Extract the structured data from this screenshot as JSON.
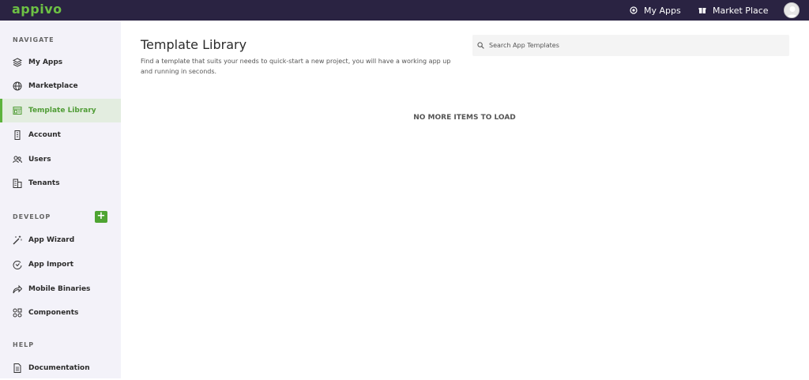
{
  "brand": {
    "logo_text": "appivo",
    "accent": "#5db33d",
    "topbar_bg": "#2a2342"
  },
  "topbar": {
    "my_apps_label": "My Apps",
    "my_apps_icon": "apps-icon",
    "market_label": "Market Place",
    "market_icon": "gift-icon"
  },
  "sidebar": {
    "navigate_label": "NAVIGATE",
    "navigate_items": [
      {
        "label": "My Apps",
        "icon": "layers-icon"
      },
      {
        "label": "Marketplace",
        "icon": "globe-icon"
      },
      {
        "label": "Template Library",
        "icon": "template-icon",
        "active": true
      },
      {
        "label": "Account",
        "icon": "building-icon"
      },
      {
        "label": "Users",
        "icon": "users-icon"
      },
      {
        "label": "Tenants",
        "icon": "buildings-icon"
      }
    ],
    "develop_label": "DEVELOP",
    "add_label": "+",
    "develop_items": [
      {
        "label": "App Wizard",
        "icon": "magic-wand-icon"
      },
      {
        "label": "App Import",
        "icon": "import-icon"
      },
      {
        "label": "Mobile Binaries",
        "icon": "share-icon"
      },
      {
        "label": "Components",
        "icon": "components-icon"
      }
    ],
    "help_label": "HELP",
    "help_items": [
      {
        "label": "Documentation",
        "icon": "document-icon"
      }
    ]
  },
  "main": {
    "title": "Template Library",
    "description": "Find a template that suits your needs to quick-start a new project, you will have a working app up and running in seconds.",
    "search_placeholder": "Search App Templates",
    "empty_message": "NO MORE ITEMS TO LOAD"
  }
}
